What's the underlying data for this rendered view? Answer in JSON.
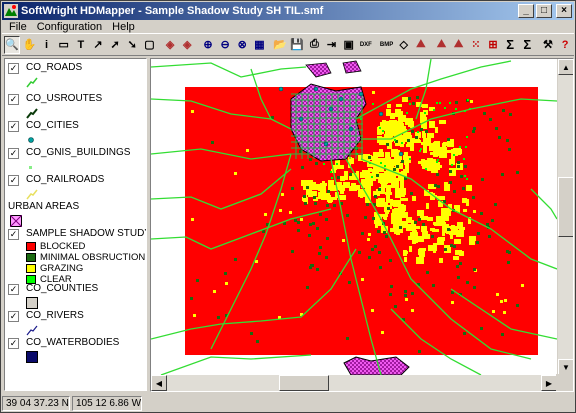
{
  "window": {
    "title": "SoftWright HDMapper - Sample Shadow Study SH TIL.smf",
    "min_glyph": "_",
    "max_glyph": "□",
    "close_glyph": "×"
  },
  "menu": [
    {
      "label": "File"
    },
    {
      "label": "Configuration"
    },
    {
      "label": "Help"
    }
  ],
  "toolbar": {
    "buttons": [
      {
        "name": "zoom-tool-icon",
        "glyph": "🔍"
      },
      {
        "name": "hand-pan-icon",
        "glyph": "✋"
      },
      {
        "name": "info-icon",
        "glyph": "i"
      },
      {
        "name": "label-icon",
        "glyph": "▭"
      },
      {
        "name": "text-tool-icon",
        "glyph": "T"
      },
      {
        "name": "measure-icon",
        "glyph": "↗"
      },
      {
        "name": "select-arrow-icon",
        "glyph": "➚"
      },
      {
        "name": "pointer-icon",
        "glyph": "➘"
      },
      {
        "name": "folder-icon",
        "glyph": "▢"
      },
      {
        "name": "layers-icon",
        "glyph": "◈"
      },
      {
        "name": "layers-edit-icon",
        "glyph": "◈"
      },
      {
        "name": "zoom-in-icon",
        "glyph": "⊕"
      },
      {
        "name": "zoom-out-icon",
        "glyph": "⊖"
      },
      {
        "name": "zoom-extent-icon",
        "glyph": "⊗"
      },
      {
        "name": "map-icon",
        "glyph": "▦"
      },
      {
        "name": "open-icon",
        "glyph": "📂"
      },
      {
        "name": "save-icon",
        "glyph": "💾"
      },
      {
        "name": "print-icon",
        "glyph": "⎙"
      },
      {
        "name": "export-icon",
        "glyph": "⇥"
      },
      {
        "name": "bitmap-icon",
        "glyph": "▣"
      },
      {
        "name": "dxf-icon",
        "glyph": "DXF"
      },
      {
        "name": "bmp-icon",
        "glyph": "BMP"
      },
      {
        "name": "compass-icon",
        "glyph": "◇"
      },
      {
        "name": "shadow-study-icon",
        "glyph": "⛰"
      },
      {
        "name": "coverage-icon",
        "glyph": "⛰"
      },
      {
        "name": "profile-icon",
        "glyph": "⛰"
      },
      {
        "name": "points-icon",
        "glyph": "⁙"
      },
      {
        "name": "grid-icon",
        "glyph": "⊞"
      },
      {
        "name": "sum-icon",
        "glyph": "Σ"
      },
      {
        "name": "sum-plus-icon",
        "glyph": "Σ"
      },
      {
        "name": "tools-icon",
        "glyph": "⚒"
      },
      {
        "name": "help-icon",
        "glyph": "?"
      }
    ]
  },
  "legend": {
    "layers": [
      {
        "name": "CO_ROADS",
        "checked": "✓"
      },
      {
        "name": "CO_USROUTES",
        "checked": "✓"
      },
      {
        "name": "CO_CITIES",
        "checked": "✓"
      },
      {
        "name": "CO_GNIS_BUILDINGS",
        "checked": "✓"
      },
      {
        "name": "CO_RAILROADS",
        "checked": "✓"
      },
      {
        "name": "URBAN AREAS",
        "checked": ""
      },
      {
        "name": "SAMPLE SHADOW STUDY SH TIL (D",
        "checked": "✓"
      },
      {
        "name": "CO_COUNTIES",
        "checked": "✓"
      },
      {
        "name": "CO_RIVERS",
        "checked": "✓"
      },
      {
        "name": "CO_WATERBODIES",
        "checked": "✓"
      }
    ],
    "classes": [
      {
        "label": "BLOCKED",
        "color": "#ff0000"
      },
      {
        "label": "MINIMAL OBSRUCTION",
        "color": "#1a6a10"
      },
      {
        "label": "GRAZING",
        "color": "#ffff00"
      },
      {
        "label": "CLEAR",
        "color": "#00ff00"
      }
    ]
  },
  "colors": {
    "blocked": "#ff0000",
    "minimal": "#1a6a10",
    "grazing": "#ffff00",
    "clear": "#00ff00",
    "roads": "#33dd33",
    "urban": "#ff66ff"
  },
  "status": {
    "latitude": "39 04 37.23 N",
    "longitude": "105 12 6.86 W"
  }
}
